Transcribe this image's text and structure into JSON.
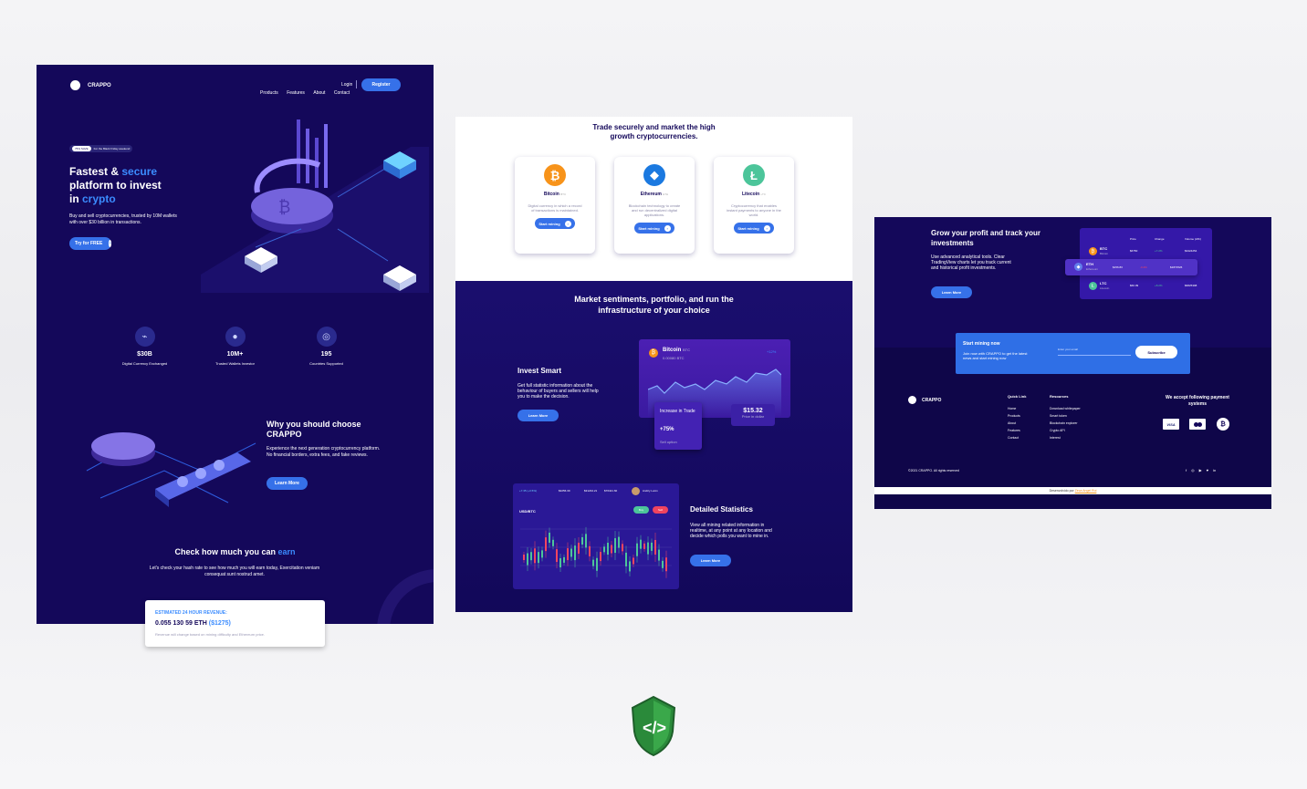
{
  "hero": {
    "brand": "CRAPPO",
    "nav": [
      "Products",
      "Features",
      "About",
      "Contact"
    ],
    "login": "Login",
    "register": "Register",
    "pill_tag": "75% SAVE",
    "pill_text": "For the Black Friday weekend",
    "title_a": "Fastest & ",
    "title_b": "secure",
    "title_c": "platform to invest",
    "title_d": "in ",
    "title_e": "crypto",
    "desc": "Buy and sell cryptocurrencies, trusted by 10M wallets with over $30 billion in transactions.",
    "cta": "Try for FREE",
    "stats": [
      {
        "icon": "chart-icon",
        "value": "$30B",
        "label": "Digital Currency Exchanged"
      },
      {
        "icon": "user-icon",
        "value": "10M+",
        "label": "Trusted Wallets Investor"
      },
      {
        "icon": "globe-icon",
        "value": "195",
        "label": "Countries Supported"
      }
    ],
    "why_title": "Why you should choose CRAPPO",
    "why_desc": "Experience the next generation cryptocurrency platform. No financial borders, extra fees, and fake reviews.",
    "why_cta": "Learn More",
    "earn_a": "Check how much you can ",
    "earn_b": "earn",
    "earn_desc": "Let's check your hash rate to see how much you will earn today, Exercitation veniam consequat sunt nostrud amet.",
    "revenue_label": "ESTIMATED 24 HOUR REVENUE:",
    "revenue_value": "0.055 130 59 ETH ",
    "revenue_usd": "($1275)",
    "revenue_note": "Revenue will change based on mining difficulty and Ethereum price."
  },
  "market": {
    "title": "Trade securely and market the high growth cryptocurrencies.",
    "cards": [
      {
        "icon": "bitcoin-icon",
        "name": "Bitcoin",
        "ticker": "BTC",
        "desc": "Digital currency in which a record of transactions is maintained.",
        "cta": "Start mining",
        "color": "#f7931a",
        "glyph": "₿"
      },
      {
        "icon": "ethereum-icon",
        "name": "Ethereum",
        "ticker": "ETH",
        "desc": "Blockchain technology to create and run decentralized digital applications.",
        "cta": "Start mining",
        "color": "#1b79e0",
        "glyph": "◆"
      },
      {
        "icon": "litecoin-icon",
        "name": "Litecoin",
        "ticker": "LTC",
        "desc": "Cryptocurrency that enables instant payments to anyone in the world.",
        "cta": "Start mining",
        "color": "#4cc59a",
        "glyph": "Ł"
      }
    ],
    "sent_title": "Market sentiments, portfolio, and run the infrastructure of your choice",
    "invest_title": "Invest Smart",
    "invest_desc": "Get full statistic information about the behaviour of buyers and sellers will help you to make the decision.",
    "invest_cta": "Learn More",
    "btc_card": {
      "name": "Bitcoin",
      "ticker": "BTC",
      "amount": "0.00080 BTC",
      "change": "+12%",
      "inc_label": "Increase in Trade",
      "inc_value": "+75%",
      "inc_action": "Sell option",
      "price": "$15.32",
      "price_label": "Price in dollar"
    },
    "detail_title": "Detailed Statistics",
    "detail_desc": "View all mining related information in realtime, at any point at any location and decide which polls you want to mine in.",
    "detail_cta": "Learn More",
    "dash": {
      "pair": "USD/BTC",
      "user": "Andriy Lunin",
      "v1": "+7.35 (+3.5%)",
      "v2": "$3256.39",
      "v3": "$31234.21",
      "v4": "$76421.60",
      "buy": "Buy",
      "sell": "Sell"
    }
  },
  "footer": {
    "grow_title": "Grow your profit and track your investments",
    "grow_desc": "Use advanced analytical tools. Clear TradingView charts let you track current and historical profit investments.",
    "grow_cta": "Learn More",
    "table_head": [
      "Price",
      "Change",
      "Volume (24h)"
    ],
    "rows": [
      {
        "sym": "BTC",
        "name": "Bitcoin",
        "price": "$6750",
        "change": "+7.2%",
        "volume": "$3424254",
        "color": "#f7931a"
      },
      {
        "sym": "ETH",
        "name": "Ethereum",
        "price": "$156.83",
        "change": "-0.4%",
        "volume": "$1872526",
        "color": "#627eea"
      },
      {
        "sym": "LTC",
        "name": "Litecoin",
        "price": "$60.09",
        "change": "+8.2%",
        "volume": "$6825398",
        "color": "#4cc59a"
      }
    ],
    "sub_title": "Start mining now",
    "sub_desc": "Join now with CRAPPO to get the latest news and start mining now",
    "sub_placeholder": "Enter your email",
    "sub_cta": "Subscribe",
    "brand": "CRAPPO",
    "quick_title": "Quick Link",
    "quick": [
      "Home",
      "Products",
      "About",
      "Features",
      "Contact"
    ],
    "res_title": "Resources",
    "res": [
      "Download whitepaper",
      "Smart token",
      "Blockchain explorer",
      "Crypto API",
      "Interest"
    ],
    "pay_title": "We accept following payment systems",
    "visa": "VISA",
    "copyright": "©2021 CRAPPO. All rights reserved",
    "credit": "Desenvolvido por",
    "author": "Zeca Angel Rui"
  }
}
